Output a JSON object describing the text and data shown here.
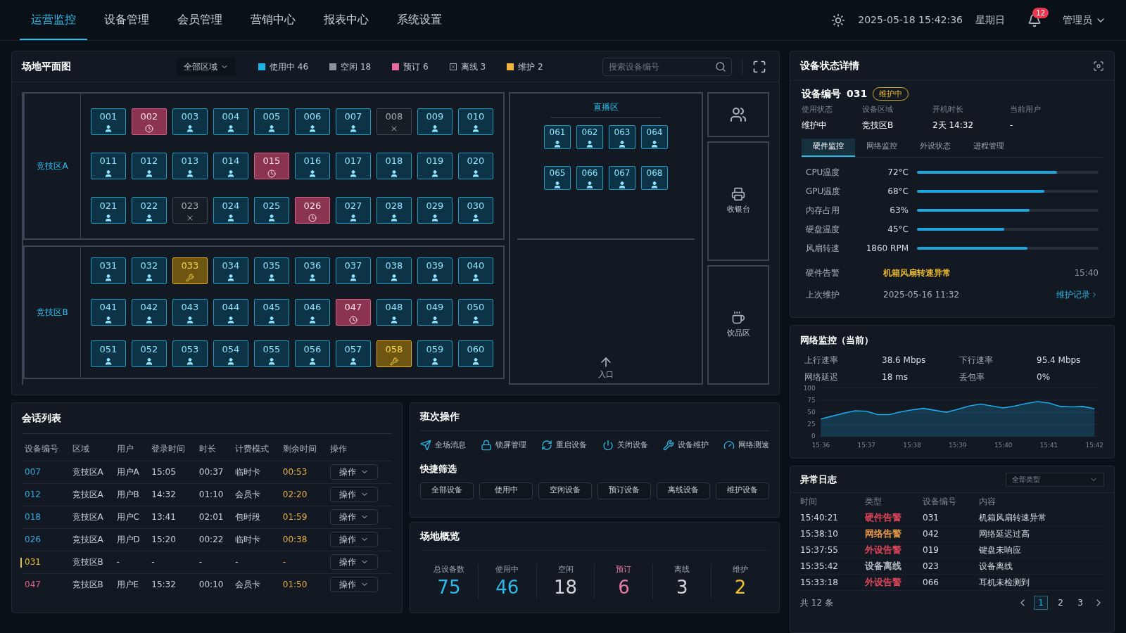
{
  "nav": {
    "tabs": [
      {
        "label": "运营监控",
        "selected": true
      },
      {
        "label": "设备管理",
        "selected": false
      },
      {
        "label": "会员管理",
        "selected": false
      },
      {
        "label": "营销中心",
        "selected": false
      },
      {
        "label": "报表中心",
        "selected": false
      },
      {
        "label": "系统设置",
        "selected": false
      }
    ],
    "datetime": "2025-05-18 15:42:36",
    "weekday": "星期日",
    "notifications": "12",
    "user": "管理员"
  },
  "floor_plan": {
    "title": "场地平面图",
    "area_filter": "全部区域",
    "legend": [
      {
        "label": "使用中 46",
        "kind": "swatch",
        "color": "#1fb4e6"
      },
      {
        "label": "空闲 18",
        "kind": "swatch",
        "color": "#8a939c"
      },
      {
        "label": "预订 6",
        "kind": "swatch",
        "color": "#e86a9a"
      },
      {
        "label": "离线 3",
        "kind": "cross",
        "color": "#9aa4ae"
      },
      {
        "label": "维护 2",
        "kind": "swatch",
        "color": "#f0b43c"
      }
    ],
    "search": {
      "placeholder": "搜索设备编号"
    },
    "zones": [
      {
        "label": "竞技区A",
        "rows": [
          [
            {
              "id": "001",
              "kind": "in_use"
            },
            {
              "id": "002",
              "kind": "reserved"
            },
            {
              "id": "003",
              "kind": "in_use"
            },
            {
              "id": "004",
              "kind": "in_use"
            },
            {
              "id": "005",
              "kind": "in_use"
            },
            {
              "id": "006",
              "kind": "in_use"
            },
            {
              "id": "007",
              "kind": "in_use"
            },
            {
              "id": "008",
              "kind": "offline"
            },
            {
              "id": "009",
              "kind": "in_use"
            },
            {
              "id": "010",
              "kind": "in_use"
            }
          ],
          [
            {
              "id": "011",
              "kind": "in_use"
            },
            {
              "id": "012",
              "kind": "in_use"
            },
            {
              "id": "013",
              "kind": "in_use"
            },
            {
              "id": "014",
              "kind": "in_use"
            },
            {
              "id": "015",
              "kind": "reserved"
            },
            {
              "id": "016",
              "kind": "in_use"
            },
            {
              "id": "017",
              "kind": "in_use"
            },
            {
              "id": "018",
              "kind": "in_use"
            },
            {
              "id": "019",
              "kind": "in_use"
            },
            {
              "id": "020",
              "kind": "in_use"
            }
          ],
          [
            {
              "id": "021",
              "kind": "in_use"
            },
            {
              "id": "022",
              "kind": "in_use"
            },
            {
              "id": "023",
              "kind": "offline"
            },
            {
              "id": "024",
              "kind": "in_use"
            },
            {
              "id": "025",
              "kind": "in_use"
            },
            {
              "id": "026",
              "kind": "reserved"
            },
            {
              "id": "027",
              "kind": "in_use"
            },
            {
              "id": "028",
              "kind": "in_use"
            },
            {
              "id": "029",
              "kind": "in_use"
            },
            {
              "id": "030",
              "kind": "in_use"
            }
          ]
        ]
      },
      {
        "label": "竞技区B",
        "rows": [
          [
            {
              "id": "031",
              "kind": "in_use"
            },
            {
              "id": "032",
              "kind": "in_use"
            },
            {
              "id": "033",
              "kind": "maintenance"
            },
            {
              "id": "034",
              "kind": "in_use"
            },
            {
              "id": "035",
              "kind": "in_use"
            },
            {
              "id": "036",
              "kind": "in_use"
            },
            {
              "id": "037",
              "kind": "in_use"
            },
            {
              "id": "038",
              "kind": "in_use"
            },
            {
              "id": "039",
              "kind": "in_use"
            },
            {
              "id": "040",
              "kind": "in_use"
            }
          ],
          [
            {
              "id": "041",
              "kind": "in_use"
            },
            {
              "id": "042",
              "kind": "in_use"
            },
            {
              "id": "043",
              "kind": "in_use"
            },
            {
              "id": "044",
              "kind": "in_use"
            },
            {
              "id": "045",
              "kind": "in_use"
            },
            {
              "id": "046",
              "kind": "in_use"
            },
            {
              "id": "047",
              "kind": "reserved"
            },
            {
              "id": "048",
              "kind": "in_use"
            },
            {
              "id": "049",
              "kind": "in_use"
            },
            {
              "id": "050",
              "kind": "in_use"
            }
          ],
          [
            {
              "id": "051",
              "kind": "in_use"
            },
            {
              "id": "052",
              "kind": "in_use"
            },
            {
              "id": "053",
              "kind": "in_use"
            },
            {
              "id": "054",
              "kind": "in_use"
            },
            {
              "id": "055",
              "kind": "in_use"
            },
            {
              "id": "056",
              "kind": "in_use"
            },
            {
              "id": "057",
              "kind": "in_use"
            },
            {
              "id": "058",
              "kind": "maintenance"
            },
            {
              "id": "059",
              "kind": "in_use"
            },
            {
              "id": "060",
              "kind": "in_use"
            }
          ]
        ]
      }
    ],
    "live_zone": {
      "label": "直播区",
      "rows": [
        [
          {
            "id": "061",
            "kind": "in_use"
          },
          {
            "id": "062",
            "kind": "in_use"
          },
          {
            "id": "063",
            "kind": "in_use"
          },
          {
            "id": "064",
            "kind": "in_use"
          }
        ],
        [
          {
            "id": "065",
            "kind": "in_use"
          },
          {
            "id": "066",
            "kind": "in_use"
          },
          {
            "id": "067",
            "kind": "in_use"
          },
          {
            "id": "068",
            "kind": "in_use"
          }
        ]
      ]
    },
    "rooms": [
      {
        "kind": "restroom"
      },
      {
        "kind": "cashier",
        "label": "收银台"
      },
      {
        "kind": "drinks",
        "label": "饮品区"
      }
    ],
    "entrance": "入口"
  },
  "sessions": {
    "title": "会话列表",
    "columns": [
      "设备编号",
      "区域",
      "用户",
      "登录时间",
      "时长",
      "计费模式",
      "剩余时间",
      "操作"
    ],
    "rows": [
      {
        "cells": [
          "007",
          "竞技区A",
          "用户A",
          "15:05",
          "00:37",
          "临时卡",
          "00:53"
        ],
        "color": "#3aa8dc",
        "selected": false,
        "action": "操作"
      },
      {
        "cells": [
          "012",
          "竞技区A",
          "用户B",
          "14:32",
          "01:10",
          "会员卡",
          "02:20"
        ],
        "color": "#3aa8dc",
        "selected": false,
        "action": "操作"
      },
      {
        "cells": [
          "018",
          "竞技区A",
          "用户C",
          "13:41",
          "02:01",
          "包时段",
          "01:59"
        ],
        "color": "#3aa8dc",
        "selected": false,
        "action": "操作"
      },
      {
        "cells": [
          "026",
          "竞技区A",
          "用户D",
          "15:20",
          "00:22",
          "临时卡",
          "00:38"
        ],
        "color": "#3aa8dc",
        "selected": false,
        "action": "操作"
      },
      {
        "cells": [
          "031",
          "竞技区B",
          "-",
          "-",
          "-",
          "-",
          "-"
        ],
        "color": "#e8c23a",
        "selected": true,
        "action": "操作"
      },
      {
        "cells": [
          "047",
          "竞技区B",
          "用户E",
          "15:32",
          "00:10",
          "会员卡",
          "01:50"
        ],
        "color": "#e0607e",
        "selected": false,
        "action": "操作"
      }
    ]
  },
  "shift_ops": {
    "title": "班次操作",
    "actions": [
      {
        "label": "全场消息",
        "kind": "send"
      },
      {
        "label": "锁屏管理",
        "kind": "lock"
      },
      {
        "label": "重启设备",
        "kind": "restart"
      },
      {
        "label": "关闭设备",
        "kind": "power"
      },
      {
        "label": "设备维护",
        "kind": "tool"
      },
      {
        "label": "网络测速",
        "kind": "gauge"
      }
    ],
    "filter_title": "快捷筛选",
    "filters": [
      "全部设备",
      "使用中",
      "空闲设备",
      "预订设备",
      "离线设备",
      "维护设备"
    ]
  },
  "overview": {
    "title": "场地概览",
    "stats": [
      {
        "label": "总设备数",
        "value": "75",
        "color": "#2cb8e8"
      },
      {
        "label": "使用中",
        "value": "46",
        "color": "#2cb8e8"
      },
      {
        "label": "空闲",
        "value": "18",
        "color": "#d0d6dc"
      },
      {
        "label": "预订",
        "value": "6",
        "color": "#e87aa8"
      },
      {
        "label": "离线",
        "value": "3",
        "color": "#d0d6dc"
      },
      {
        "label": "维护",
        "value": "2",
        "color": "#f0c030"
      }
    ]
  },
  "device_detail": {
    "title": "设备状态详情",
    "device_label": "设备编号",
    "device_id": "031",
    "badge": "维护中",
    "info": [
      {
        "label": "使用状态",
        "value": "维护中"
      },
      {
        "label": "设备区域",
        "value": "竞技区B"
      },
      {
        "label": "开机时长",
        "value": "2天 14:32"
      },
      {
        "label": "当前用户",
        "value": "-"
      }
    ],
    "tabs": [
      {
        "label": "硬件监控",
        "selected": true
      },
      {
        "label": "网络监控",
        "selected": false
      },
      {
        "label": "外设状态",
        "selected": false
      },
      {
        "label": "进程管理",
        "selected": false
      }
    ],
    "meters": [
      {
        "label": "CPU温度",
        "reading": "72°C",
        "level": 0.77
      },
      {
        "label": "GPU温度",
        "reading": "68°C",
        "level": 0.7
      },
      {
        "label": "内存占用",
        "reading": "63%",
        "level": 0.62
      },
      {
        "label": "硬盘温度",
        "reading": "45°C",
        "level": 0.48
      },
      {
        "label": "风扇转速",
        "reading": "1860 RPM",
        "level": 0.61
      }
    ],
    "alert": {
      "label": "硬件告警",
      "text": "机箱风扇转速异常",
      "time": "15:40"
    },
    "maintenance": {
      "label": "上次维护",
      "value": "2025-05-16 11:32",
      "link": "维护记录"
    }
  },
  "network": {
    "title": "网络监控（当前）",
    "stats": [
      {
        "label": "上行速率",
        "value": "38.6 Mbps"
      },
      {
        "label": "下行速率",
        "value": "95.4 Mbps"
      },
      {
        "label": "网络延迟",
        "value": "18 ms"
      },
      {
        "label": "丢包率",
        "value": "0%"
      }
    ],
    "chart_data": {
      "type": "area",
      "categories": [
        "15:36",
        null,
        null,
        null,
        "15:37",
        null,
        null,
        null,
        "15:38",
        null,
        null,
        null,
        "15:39",
        null,
        null,
        null,
        "15:40",
        null,
        null,
        null,
        "15:41",
        null,
        null,
        null,
        "15:42"
      ],
      "series": [
        {
          "color": "#1ea8e8",
          "values": [
            36,
            42,
            48,
            53,
            52,
            45,
            45,
            51,
            55,
            58,
            54,
            50,
            56,
            63,
            67,
            63,
            59,
            63,
            68,
            72,
            69,
            62,
            61,
            62,
            57
          ]
        }
      ],
      "ylim": [
        0,
        100
      ],
      "yticks": [
        0,
        25,
        50,
        75,
        100
      ],
      "grid": true
    }
  },
  "log": {
    "title": "异常日志",
    "filter": "全部类型",
    "columns": [
      "时间",
      "类型",
      "设备编号",
      "内容"
    ],
    "rows": [
      {
        "time": "15:40:21",
        "type": "硬件告警",
        "color": "#e0455a",
        "device": "031",
        "content": "机箱风扇转速异常"
      },
      {
        "time": "15:38:10",
        "type": "网络告警",
        "color": "#e89a4a",
        "device": "042",
        "content": "网络延迟过高"
      },
      {
        "time": "15:37:55",
        "type": "外设告警",
        "color": "#e0455a",
        "device": "019",
        "content": "键盘未响应"
      },
      {
        "time": "15:35:42",
        "type": "设备离线",
        "color": "#b0b8c0",
        "device": "023",
        "content": "设备离线"
      },
      {
        "time": "15:33:18",
        "type": "外设告警",
        "color": "#e0455a",
        "device": "066",
        "content": "耳机未检测到"
      }
    ],
    "total": "共 12 条",
    "pages": [
      {
        "label": "1",
        "selected": true
      },
      {
        "label": "2",
        "selected": false
      },
      {
        "label": "3",
        "selected": false
      }
    ]
  }
}
